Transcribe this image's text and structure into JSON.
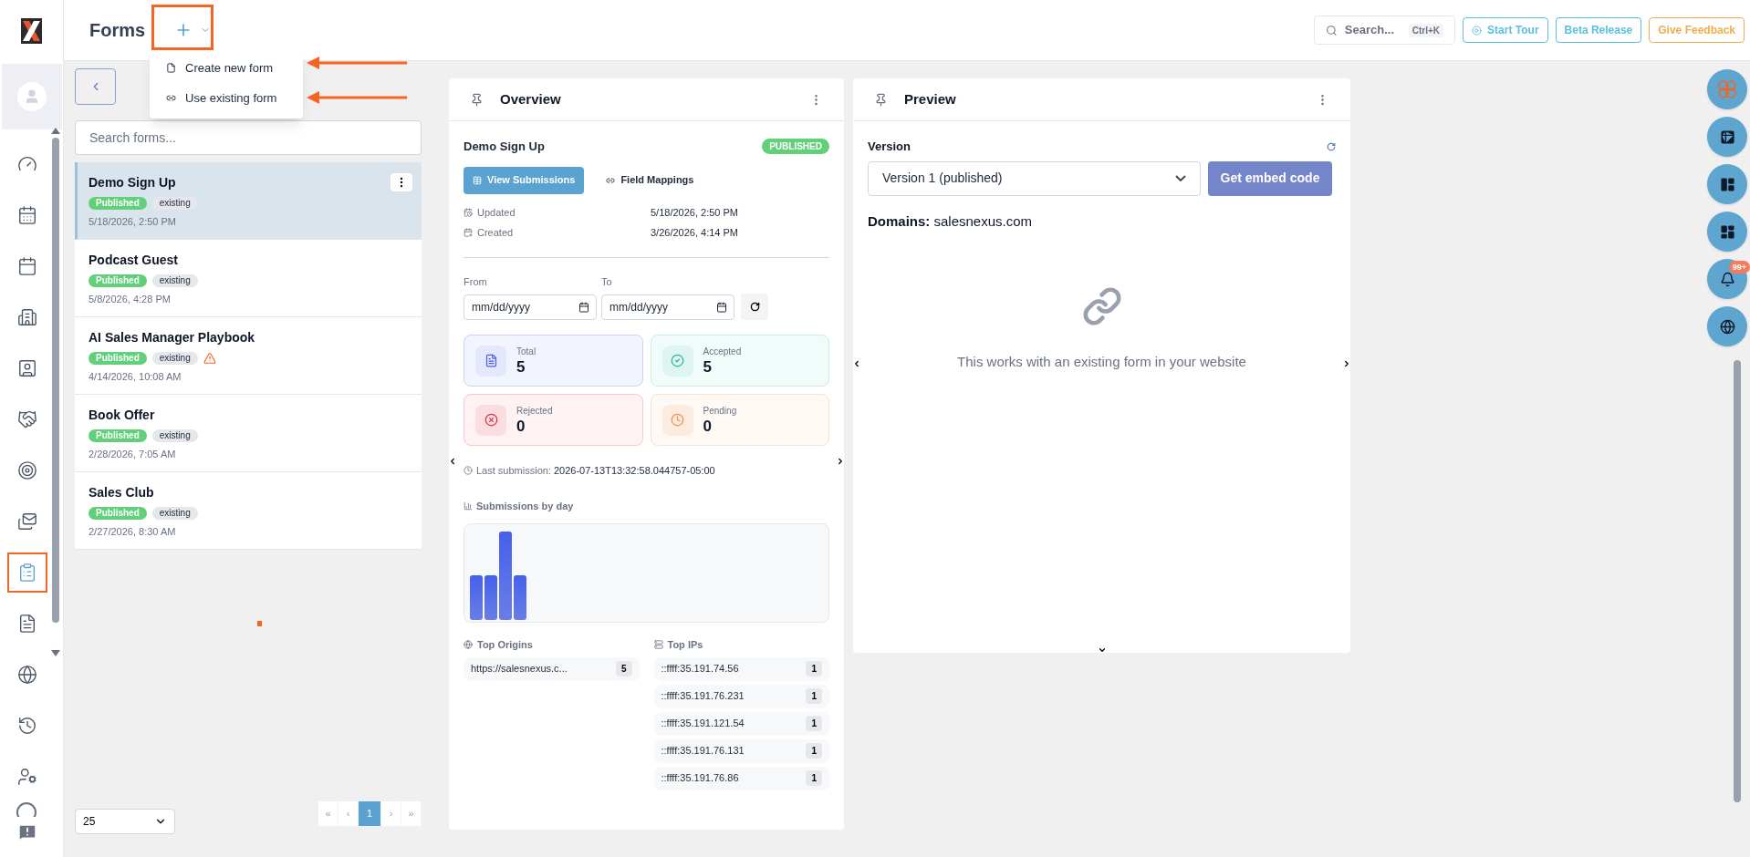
{
  "sidebar": {
    "items": [
      {
        "kind": "gauge",
        "selected": false
      },
      {
        "kind": "calendar",
        "selected": false
      },
      {
        "kind": "schedule",
        "selected": false
      },
      {
        "kind": "building",
        "selected": false
      },
      {
        "kind": "contact",
        "selected": false
      },
      {
        "kind": "handshake",
        "selected": false
      },
      {
        "kind": "target",
        "selected": false
      },
      {
        "kind": "mail",
        "selected": false
      },
      {
        "kind": "forms",
        "selected": true
      },
      {
        "kind": "document",
        "selected": false
      },
      {
        "kind": "globe",
        "selected": false
      },
      {
        "kind": "history",
        "selected": false
      },
      {
        "kind": "usercog",
        "selected": false
      }
    ]
  },
  "header": {
    "title": "Forms",
    "search": {
      "placeholder": "Search...",
      "shortcut": "Ctrl+K"
    },
    "buttons": [
      {
        "label": "Start Tour",
        "kind": "tour",
        "color": "#5bc0de"
      },
      {
        "label": "Beta Release",
        "kind": "plain",
        "color": "#5bc0de"
      },
      {
        "label": "Give Feedback",
        "kind": "plain",
        "color": "#f0ad4e"
      }
    ]
  },
  "add_menu": {
    "items": [
      {
        "label": "Create new form",
        "kind": "file"
      },
      {
        "label": "Use existing form",
        "kind": "link"
      }
    ]
  },
  "forms_list": {
    "search_placeholder": "Search forms...",
    "items": [
      {
        "name": "Demo Sign Up",
        "status": "Published",
        "type": "existing",
        "date": "5/18/2026, 2:50 PM",
        "selected": true,
        "warning": false
      },
      {
        "name": "Podcast Guest",
        "status": "Published",
        "type": "existing",
        "date": "5/8/2026, 4:28 PM",
        "selected": false,
        "warning": false
      },
      {
        "name": "AI Sales Manager Playbook",
        "status": "Published",
        "type": "existing",
        "date": "4/14/2026, 10:08 AM",
        "selected": false,
        "warning": true
      },
      {
        "name": "Book Offer",
        "status": "Published",
        "type": "existing",
        "date": "2/28/2026, 7:05 AM",
        "selected": false,
        "warning": false
      },
      {
        "name": "Sales Club",
        "status": "Published",
        "type": "existing",
        "date": "2/27/2026, 8:30 AM",
        "selected": false,
        "warning": false
      }
    ],
    "page_size": "25",
    "pagination": [
      {
        "label": "«",
        "selected": false
      },
      {
        "label": "‹",
        "selected": false
      },
      {
        "label": "1",
        "selected": true
      },
      {
        "label": "›",
        "selected": false
      },
      {
        "label": "»",
        "selected": false
      }
    ]
  },
  "overview": {
    "title": "Overview",
    "form_name": "Demo Sign Up",
    "status": "PUBLISHED",
    "tabs": [
      {
        "label": "View Submissions",
        "kind": "grid",
        "selected": true
      },
      {
        "label": "Field Mappings",
        "kind": "link",
        "selected": false
      }
    ],
    "meta": [
      {
        "label": "Updated",
        "kind": "updated",
        "value": "5/18/2026, 2:50 PM"
      },
      {
        "label": "Created",
        "kind": "created",
        "value": "3/26/2026, 4:14 PM"
      }
    ],
    "from": {
      "label": "From",
      "placeholder": "mm/dd/yyyy"
    },
    "to": {
      "label": "To",
      "placeholder": "mm/dd/yyyy"
    },
    "stats": [
      {
        "label": "Total",
        "value": "5",
        "kind": "total"
      },
      {
        "label": "Accepted",
        "value": "5",
        "kind": "accepted"
      },
      {
        "label": "Rejected",
        "value": "0",
        "kind": "rejected"
      },
      {
        "label": "Pending",
        "value": "0",
        "kind": "pending"
      }
    ],
    "last_submission": {
      "label": "Last submission:",
      "value": "2026-07-13T13:32:58.044757-05:00"
    },
    "chart_title": "Submissions by day",
    "top_origins": {
      "title": "Top Origins",
      "items": [
        {
          "label": "https://salesnexus.c...",
          "count": "5"
        }
      ]
    },
    "top_ips": {
      "title": "Top IPs",
      "items": [
        {
          "label": "::ffff:35.191.74.56",
          "count": "1"
        },
        {
          "label": "::ffff:35.191.76.231",
          "count": "1"
        },
        {
          "label": "::ffff:35.191.121.54",
          "count": "1"
        },
        {
          "label": "::ffff:35.191.76.131",
          "count": "1"
        },
        {
          "label": "::ffff:35.191.76.86",
          "count": "1"
        }
      ]
    }
  },
  "preview": {
    "title": "Preview",
    "version_label": "Version",
    "version_value": "Version 1 (published)",
    "embed_button": "Get embed code",
    "domains": "**Domains:** salesnexus.com",
    "empty_message": "This works with an existing form in your website"
  },
  "floating_buttons": [
    {
      "kind": "logo"
    },
    {
      "kind": "table"
    },
    {
      "kind": "layout"
    },
    {
      "kind": "dashboard"
    },
    {
      "kind": "bell",
      "badge": "99+"
    },
    {
      "kind": "globe"
    }
  ]
}
